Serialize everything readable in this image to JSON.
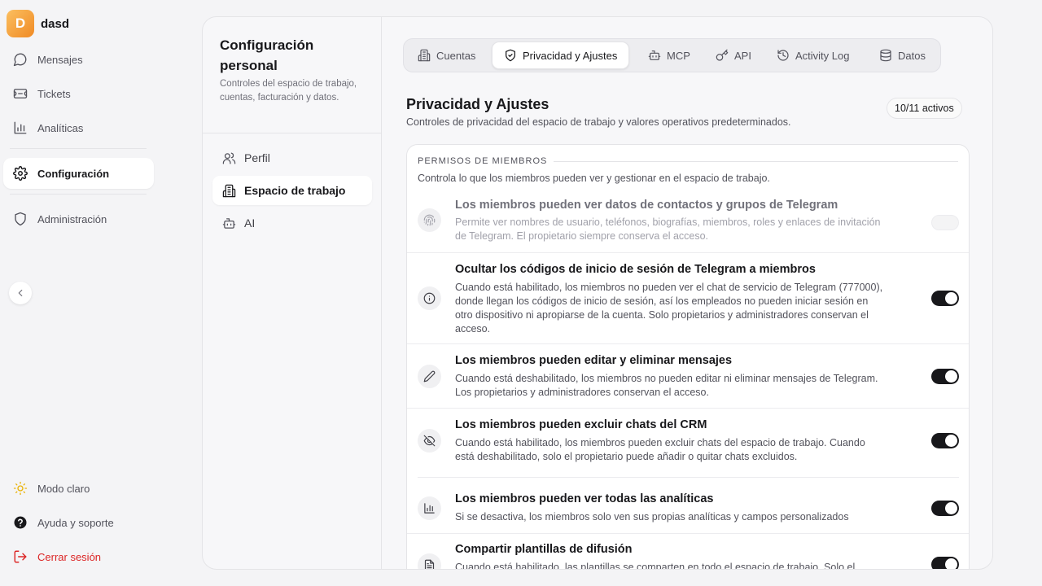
{
  "sidebar": {
    "brand": {
      "initial": "D",
      "name": "dasd"
    },
    "nav": [
      {
        "label": "Mensajes",
        "icon": "message-icon"
      },
      {
        "label": "Tickets",
        "icon": "ticket-icon"
      },
      {
        "label": "Analíticas",
        "icon": "chart-icon"
      },
      {
        "label": "Configuración",
        "icon": "gear-icon",
        "active": true
      },
      {
        "label": "Administración",
        "icon": "shield-icon"
      }
    ],
    "bottom": [
      {
        "label": "Modo claro",
        "icon": "sun-icon"
      },
      {
        "label": "Ayuda y soporte",
        "icon": "help-icon"
      },
      {
        "label": "Cerrar sesión",
        "icon": "logout-icon"
      }
    ]
  },
  "settings": {
    "title": "Configuración personal",
    "description": "Controles del espacio de trabajo, cuentas, facturación y datos.",
    "items": [
      {
        "label": "Perfil",
        "icon": "users-icon"
      },
      {
        "label": "Espacio de trabajo",
        "icon": "building-icon",
        "active": true
      },
      {
        "label": "AI",
        "icon": "bot-icon"
      }
    ]
  },
  "tabs": [
    {
      "label": "Cuentas",
      "icon": "building-icon"
    },
    {
      "label": "Privacidad y Ajustes",
      "icon": "shield-check-icon",
      "active": true
    },
    {
      "label": "MCP",
      "icon": "bot-icon"
    },
    {
      "label": "API",
      "icon": "key-icon"
    },
    {
      "label": "Activity Log",
      "icon": "history-icon"
    },
    {
      "label": "Datos",
      "icon": "database-icon"
    }
  ],
  "section": {
    "title": "Privacidad y Ajustes",
    "subtitle": "Controles de privacidad del espacio de trabajo y valores operativos predeterminados.",
    "badge": "10/11 activos"
  },
  "permissions": {
    "group_label": "Permisos de miembros",
    "group_desc": "Controla lo que los miembros pueden ver y gestionar en el espacio de trabajo.",
    "rows": [
      {
        "title": "Los miembros pueden ver datos de contactos y grupos de Telegram",
        "desc": "Permite ver nombres de usuario, teléfonos, biografías, miembros, roles y enlaces de invitación de Telegram. El propietario siempre conserva el acceso.",
        "icon": "fingerprint-icon",
        "enabled": false,
        "disabled": true
      },
      {
        "title": "Ocultar los códigos de inicio de sesión de Telegram a miembros",
        "desc": "Cuando está habilitado, los miembros no pueden ver el chat de servicio de Telegram (777000), donde llegan los códigos de inicio de sesión, así los empleados no pueden iniciar sesión en otro dispositivo ni apropiarse de la cuenta. Solo propietarios y administradores conservan el acceso.",
        "icon": "info-icon",
        "enabled": true
      },
      {
        "title": "Los miembros pueden editar y eliminar mensajes",
        "desc": "Cuando está deshabilitado, los miembros no pueden editar ni eliminar mensajes de Telegram. Los propietarios y administradores conservan el acceso.",
        "icon": "pencil-icon",
        "enabled": true
      },
      {
        "title": "Los miembros pueden excluir chats del CRM",
        "desc": "Cuando está habilitado, los miembros pueden excluir chats del espacio de trabajo. Cuando está deshabilitado, solo el propietario puede añadir o quitar chats excluidos.",
        "icon": "eye-off-icon",
        "enabled": true
      },
      {
        "title": "Los miembros pueden ver todas las analíticas",
        "desc": "Si se desactiva, los miembros solo ven sus propias analíticas y campos personalizados",
        "icon": "chart-icon",
        "enabled": true
      },
      {
        "title": "Compartir plantillas de difusión",
        "desc": "Cuando está habilitado, las plantillas se comparten en todo el espacio de trabajo. Solo el",
        "icon": "file-icon",
        "enabled": true
      }
    ]
  }
}
